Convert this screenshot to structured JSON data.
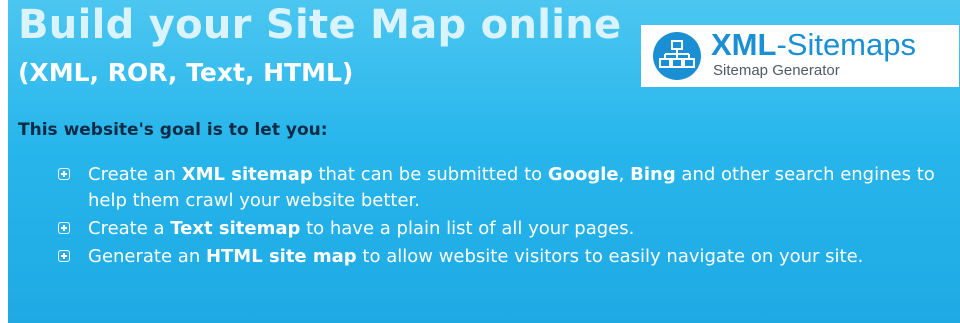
{
  "banner": {
    "title": "Build your Site Map online",
    "subtitle": "(XML, ROR, Text, HTML)"
  },
  "logo": {
    "brand_bold": "XML",
    "brand_rest": "-Sitemaps",
    "tagline": "Sitemap Generator",
    "icon": "sitemap-tree-icon"
  },
  "intro": "This website's goal is to let you:",
  "goals": [
    {
      "icon": "plus-square-icon",
      "parts": [
        {
          "t": "Create an ",
          "b": false
        },
        {
          "t": "XML sitemap",
          "b": true
        },
        {
          "t": " that can be submitted to ",
          "b": false
        },
        {
          "t": "Google",
          "b": true
        },
        {
          "t": ", ",
          "b": false
        },
        {
          "t": "Bing",
          "b": true
        },
        {
          "t": " and other search engines to help them crawl your website better.",
          "b": false
        }
      ]
    },
    {
      "icon": "plus-square-icon",
      "parts": [
        {
          "t": "Create a ",
          "b": false
        },
        {
          "t": "Text sitemap",
          "b": true
        },
        {
          "t": " to have a plain list of all your pages.",
          "b": false
        }
      ]
    },
    {
      "icon": "plus-square-icon",
      "parts": [
        {
          "t": "Generate an ",
          "b": false
        },
        {
          "t": "HTML site map",
          "b": true
        },
        {
          "t": " to allow website visitors to easily navigate on your site.",
          "b": false
        }
      ]
    }
  ],
  "colors": {
    "background": "#27b6ec",
    "title": "#d9f4ff",
    "intro": "#0f2b44",
    "logo_blue": "#1a8fd4"
  }
}
